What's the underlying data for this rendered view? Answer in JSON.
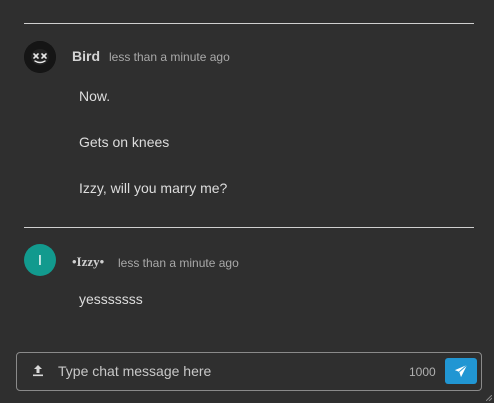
{
  "messages": [
    {
      "username": "Bird",
      "timestamp": "less than a minute ago",
      "avatar_icon": "skull-face-icon",
      "lines": [
        "Now.",
        "Gets on knees",
        "Izzy, will you marry me?"
      ]
    },
    {
      "username": "•Izzy•",
      "timestamp": "less than a minute ago",
      "avatar_letter": "I",
      "avatar_color": "#129a8e",
      "lines": [
        "yesssssss"
      ]
    }
  ],
  "composer": {
    "placeholder": "Type chat message here",
    "char_count": "1000",
    "upload_icon": "upload-icon",
    "send_icon": "paper-plane-icon",
    "send_color": "#2196d3"
  }
}
